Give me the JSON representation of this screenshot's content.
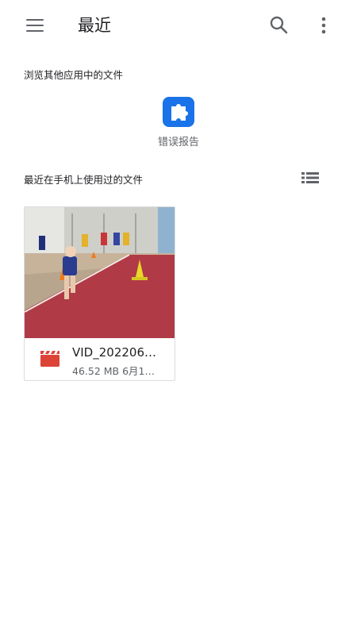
{
  "header": {
    "title": "最近",
    "menu_icon": "hamburger-menu-icon",
    "search_icon": "search-icon",
    "more_icon": "more-vert-icon"
  },
  "browse_section": {
    "label": "浏览其他应用中的文件",
    "items": [
      {
        "label": "错误报告",
        "icon": "puzzle-piece-icon",
        "color": "#1a73e8"
      }
    ]
  },
  "recent_section": {
    "label": "最近在手机上使用过的文件",
    "view_toggle_icon": "list-view-icon",
    "files": [
      {
        "name": "VID_202206…",
        "meta": "46.52 MB 6月1…",
        "type_icon": "video-clapper-icon",
        "type_color": "#db4437"
      }
    ]
  }
}
